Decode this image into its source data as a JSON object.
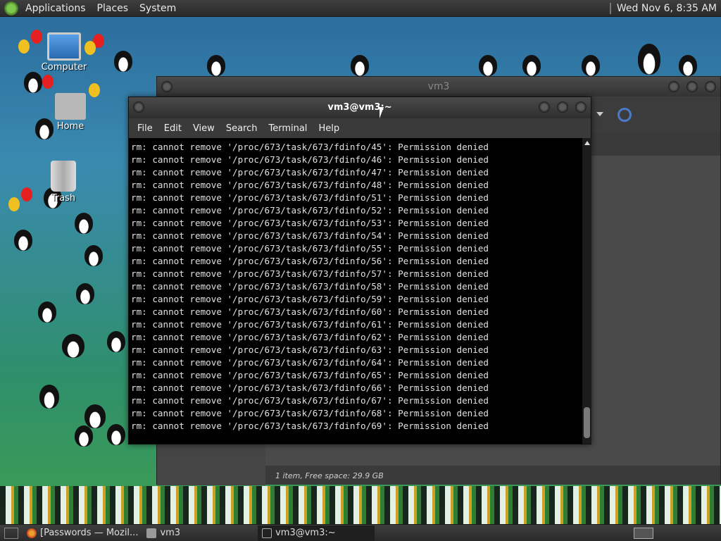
{
  "top_panel": {
    "menus": [
      "Applications",
      "Places",
      "System"
    ],
    "clock": "Wed Nov  6,  8:35 AM"
  },
  "desktop": {
    "icons": [
      {
        "label": "Computer"
      },
      {
        "label": "Home"
      },
      {
        "label": "Trash"
      }
    ]
  },
  "file_manager": {
    "title": "vm3",
    "status": "1 item, Free space: 29.9 GB"
  },
  "terminal": {
    "title": "vm3@vm3:~",
    "menu": [
      "File",
      "Edit",
      "View",
      "Search",
      "Terminal",
      "Help"
    ],
    "lines": [
      "rm: cannot remove '/proc/673/task/673/fdinfo/45': Permission denied",
      "rm: cannot remove '/proc/673/task/673/fdinfo/46': Permission denied",
      "rm: cannot remove '/proc/673/task/673/fdinfo/47': Permission denied",
      "rm: cannot remove '/proc/673/task/673/fdinfo/48': Permission denied",
      "rm: cannot remove '/proc/673/task/673/fdinfo/51': Permission denied",
      "rm: cannot remove '/proc/673/task/673/fdinfo/52': Permission denied",
      "rm: cannot remove '/proc/673/task/673/fdinfo/53': Permission denied",
      "rm: cannot remove '/proc/673/task/673/fdinfo/54': Permission denied",
      "rm: cannot remove '/proc/673/task/673/fdinfo/55': Permission denied",
      "rm: cannot remove '/proc/673/task/673/fdinfo/56': Permission denied",
      "rm: cannot remove '/proc/673/task/673/fdinfo/57': Permission denied",
      "rm: cannot remove '/proc/673/task/673/fdinfo/58': Permission denied",
      "rm: cannot remove '/proc/673/task/673/fdinfo/59': Permission denied",
      "rm: cannot remove '/proc/673/task/673/fdinfo/60': Permission denied",
      "rm: cannot remove '/proc/673/task/673/fdinfo/61': Permission denied",
      "rm: cannot remove '/proc/673/task/673/fdinfo/62': Permission denied",
      "rm: cannot remove '/proc/673/task/673/fdinfo/63': Permission denied",
      "rm: cannot remove '/proc/673/task/673/fdinfo/64': Permission denied",
      "rm: cannot remove '/proc/673/task/673/fdinfo/65': Permission denied",
      "rm: cannot remove '/proc/673/task/673/fdinfo/66': Permission denied",
      "rm: cannot remove '/proc/673/task/673/fdinfo/67': Permission denied",
      "rm: cannot remove '/proc/673/task/673/fdinfo/68': Permission denied",
      "rm: cannot remove '/proc/673/task/673/fdinfo/69': Permission denied"
    ]
  },
  "taskbar": {
    "items": [
      {
        "label": "[Passwords — Mozil...",
        "icon": "firefox-icon"
      },
      {
        "label": "vm3",
        "icon": "folder-icon"
      },
      {
        "label": "vm3@vm3:~",
        "icon": "terminal-icon"
      }
    ]
  },
  "colors": {
    "panel": "#2e2e2e",
    "terminal_bg": "#000000",
    "terminal_fg": "#e0e0e0"
  }
}
